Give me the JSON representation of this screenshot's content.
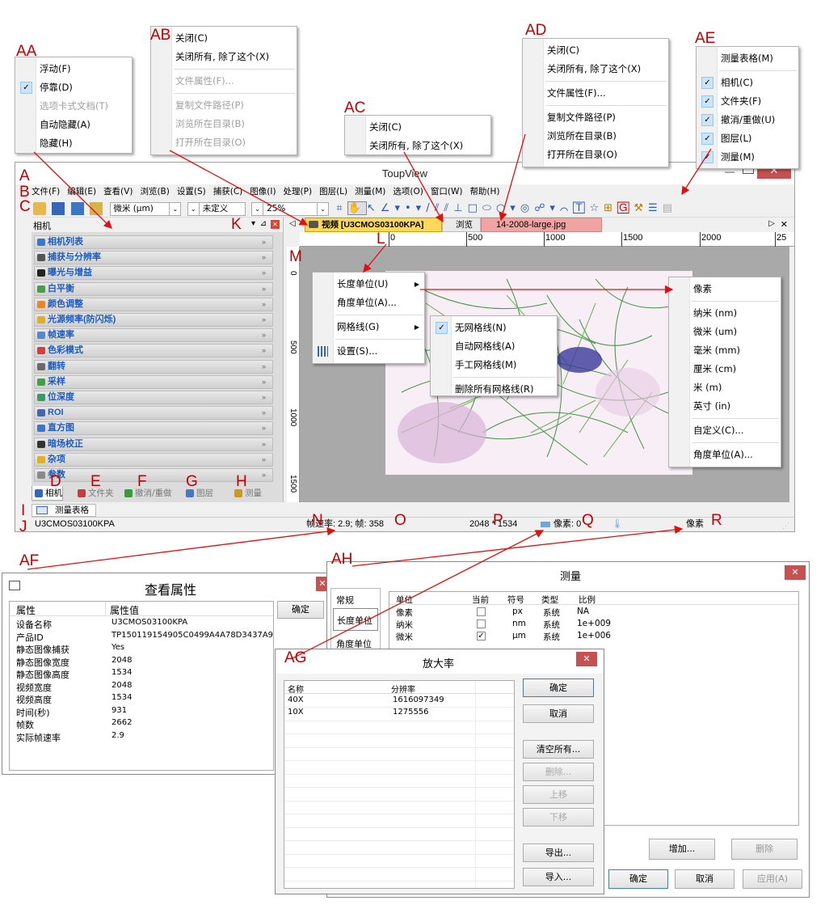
{
  "labels": {
    "AA": "AA",
    "AB": "AB",
    "AC": "AC",
    "AD": "AD",
    "AE": "AE",
    "AF": "AF",
    "AG": "AG",
    "AH": "AH",
    "A": "A",
    "B": "B",
    "C": "C",
    "D": "D",
    "E": "E",
    "F": "F",
    "G": "G",
    "H": "H",
    "I": "I",
    "J": "J",
    "K": "K",
    "L": "L",
    "M": "M",
    "N": "N",
    "O": "O",
    "P": "P",
    "Q": "Q",
    "R": "R"
  },
  "menu_aa": {
    "items": [
      "浮动(F)",
      "停靠(D)",
      "选项卡式文档(T)",
      "自动隐藏(A)",
      "隐藏(H)"
    ]
  },
  "menu_ab": {
    "items": [
      "关闭(C)",
      "关闭所有, 除了这个(X)",
      "文件属性(F)...",
      "复制文件路径(P)",
      "浏览所在目录(B)",
      "打开所在目录(O)"
    ]
  },
  "menu_ac": {
    "items": [
      "关闭(C)",
      "关闭所有, 除了这个(X)"
    ]
  },
  "menu_ad": {
    "items": [
      "关闭(C)",
      "关闭所有, 除了这个(X)",
      "文件属性(F)...",
      "复制文件路径(P)",
      "浏览所在目录(B)",
      "打开所在目录(O)"
    ]
  },
  "menu_ae": {
    "items": [
      "测量表格(M)",
      "相机(C)",
      "文件夹(F)",
      "撤消/重做(U)",
      "图层(L)",
      "测量(M)"
    ]
  },
  "app": {
    "title": "ToupView",
    "menubar": [
      "文件(F)",
      "编辑(E)",
      "查看(V)",
      "浏览(B)",
      "设置(S)",
      "捕获(C)",
      "图像(I)",
      "处理(P)",
      "图层(L)",
      "测量(M)",
      "选项(O)",
      "窗口(W)",
      "帮助(H)"
    ],
    "unit_select": "微米 (µm)",
    "cal_select": "未定义",
    "zoom_select": "25%",
    "panel_title": "相机",
    "panel_rows": [
      "相机列表",
      "捕获与分辨率",
      "曝光与增益",
      "白平衡",
      "颜色调整",
      "光源频率(防闪烁)",
      "帧速率",
      "色彩模式",
      "翻转",
      "采样",
      "位深度",
      "ROI",
      "直方图",
      "暗场校正",
      "杂项",
      "参数"
    ],
    "panel_tabs": [
      "相机",
      "文件夹",
      "撤消/重做",
      "图层",
      "测量"
    ],
    "tabs": [
      "视频 [U3CMOS03100KPA]",
      "浏览",
      "14-2008-large.jpg"
    ],
    "ruler": [
      "0",
      "500",
      "1000",
      "1500",
      "2000",
      "25"
    ],
    "vruler": [
      "0",
      "500",
      "1000",
      "1500"
    ],
    "bottom_tab": "测量表格",
    "status": {
      "camera": "U3CMOS03100KPA",
      "fps": "帧速率: 2.9; 帧: 358",
      "size": "2048 * 1534",
      "pix": "像素: 0",
      "unit": "像素"
    }
  },
  "ctx_menu": {
    "items": [
      "长度单位(U)",
      "角度单位(A)...",
      "网格线(G)",
      "设置(S)..."
    ]
  },
  "grid_menu": {
    "items": [
      "无网格线(N)",
      "自动网格线(A)",
      "手工网格线(M)",
      "删除所有网格线(R)"
    ]
  },
  "unit_menu": {
    "items": [
      "像素",
      "纳米 (nm)",
      "微米 (um)",
      "毫米 (mm)",
      "厘米 (cm)",
      "米 (m)",
      "英寸 (in)",
      "自定义(C)...",
      "角度单位(A)..."
    ]
  },
  "props": {
    "title": "查看属性",
    "ok": "确定",
    "headers": [
      "属性",
      "属性值"
    ],
    "rows": [
      [
        "设备名称",
        "U3CMOS03100KPA"
      ],
      [
        "产品ID",
        "TP150119154905C0499A4A78D3437A9"
      ],
      [
        "静态图像捕获",
        "Yes"
      ],
      [
        "静态图像宽度",
        "2048"
      ],
      [
        "静态图像高度",
        "1534"
      ],
      [
        "视频宽度",
        "2048"
      ],
      [
        "视频高度",
        "1534"
      ],
      [
        "时间(秒)",
        "931"
      ],
      [
        "帧数",
        "2662"
      ],
      [
        "实际帧速率",
        "2.9"
      ]
    ]
  },
  "measure": {
    "title": "测量",
    "side": [
      "常规",
      "长度单位",
      "角度单位"
    ],
    "headers": [
      "单位",
      "当前",
      "符号",
      "类型",
      "比例"
    ],
    "rows": [
      [
        "像素",
        "",
        "px",
        "系统",
        "NA"
      ],
      [
        "纳米",
        "",
        "nm",
        "系统",
        "1e+009"
      ],
      [
        "微米",
        "✓",
        "µm",
        "系统",
        "1e+006"
      ]
    ],
    "add": "增加...",
    "del": "删除",
    "ok": "确定",
    "cancel": "取消",
    "apply": "应用(A)"
  },
  "mag": {
    "title": "放大率",
    "headers": [
      "名称",
      "分辨率"
    ],
    "rows": [
      [
        "40X",
        "1616097349"
      ],
      [
        "10X",
        "1275556"
      ]
    ],
    "buttons": [
      "确定",
      "取消",
      "清空所有...",
      "删除...",
      "上移",
      "下移",
      "导出...",
      "导入..."
    ]
  }
}
